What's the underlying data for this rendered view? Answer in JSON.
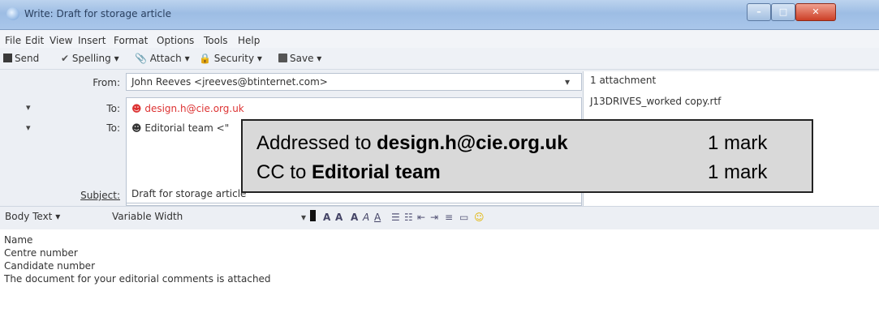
{
  "window": {
    "title": "Write: Draft for storage article"
  },
  "window_controls": {
    "minimize": "–",
    "maximize": "□",
    "close": "✕"
  },
  "menu": [
    "File",
    "Edit",
    "View",
    "Insert",
    "Format",
    "Options",
    "Tools",
    "Help"
  ],
  "toolbar": {
    "send": "Send",
    "spelling": "Spelling",
    "attach": "Attach",
    "security": "Security",
    "save": "Save"
  },
  "header": {
    "from_label": "From:",
    "from_value": "John Reeves <jreeves@btinternet.com>",
    "to_label": "To:",
    "to_value": "design.h@cie.org.uk",
    "cc_label": "To:",
    "cc_value": "Editorial team <\"",
    "subject_label": "Subject:",
    "subject_value": "Draft for storage article"
  },
  "attachments": {
    "count_label": "1 attachment",
    "file_name": "J13DRIVES_worked copy.rtf"
  },
  "format_bar": {
    "paragraph_style": "Body Text",
    "font": "Variable Width"
  },
  "body": {
    "lines": [
      "Name",
      "Centre number",
      "Candidate number",
      "The document for your editorial comments is attached"
    ]
  },
  "callout": {
    "row1_prefix": "Addressed to ",
    "row1_bold": "design.h@cie.org.uk",
    "row1_mark": "1 mark",
    "row2_prefix": "CC to ",
    "row2_bold": "Editorial team",
    "row2_mark": "1 mark"
  }
}
